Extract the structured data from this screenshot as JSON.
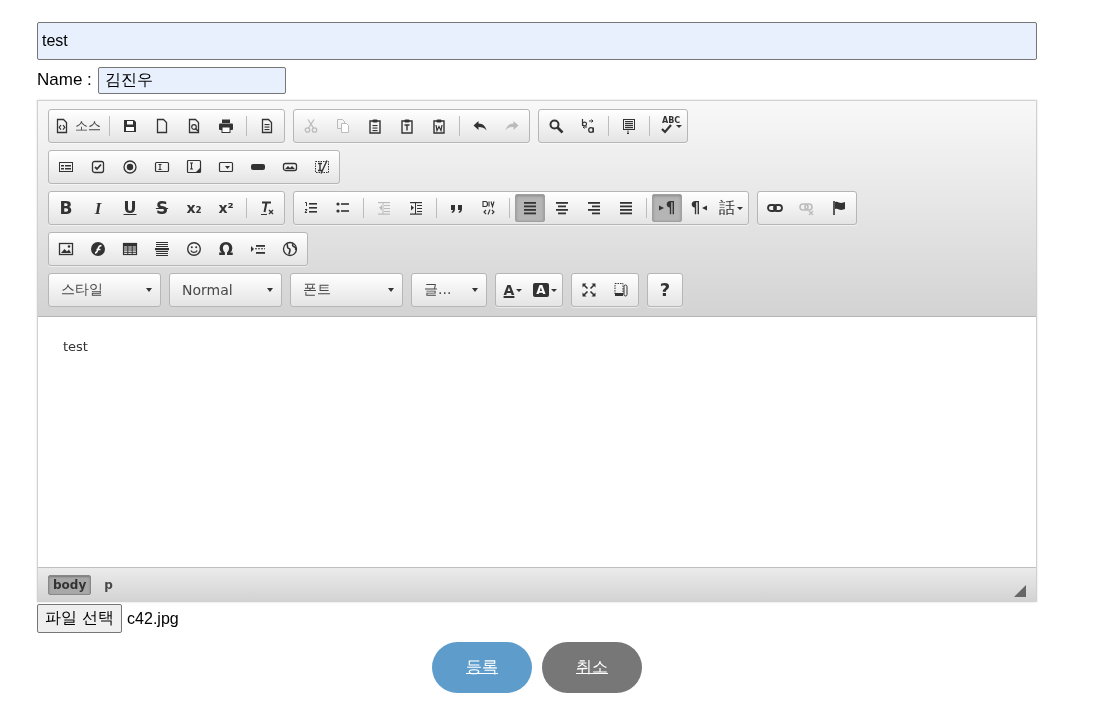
{
  "title_field": {
    "value": "test"
  },
  "name_field": {
    "label": "Name :",
    "value": "김진우"
  },
  "editor": {
    "toolbar": [
      {
        "items": [
          {
            "kind": "group",
            "items": [
              {
                "kind": "button",
                "label": "소스",
                "disabled": false
              },
              {
                "kind": "separator"
              },
              {
                "kind": "button",
                "disabled": false
              },
              {
                "kind": "button",
                "disabled": false
              },
              {
                "kind": "button",
                "disabled": false
              },
              {
                "kind": "button",
                "disabled": false
              },
              {
                "kind": "separator"
              },
              {
                "kind": "button",
                "disabled": false
              }
            ]
          },
          {
            "kind": "group",
            "items": [
              {
                "kind": "button",
                "disabled": true
              },
              {
                "kind": "button",
                "disabled": true
              },
              {
                "kind": "button",
                "disabled": false
              },
              {
                "kind": "button",
                "disabled": false
              },
              {
                "kind": "button",
                "disabled": false
              },
              {
                "kind": "separator"
              },
              {
                "kind": "button",
                "disabled": false
              },
              {
                "kind": "button",
                "disabled": true
              }
            ]
          },
          {
            "kind": "group",
            "items": [
              {
                "kind": "button",
                "disabled": false
              },
              {
                "kind": "button",
                "disabled": false
              },
              {
                "kind": "separator"
              },
              {
                "kind": "button",
                "disabled": false
              },
              {
                "kind": "separator"
              },
              {
                "kind": "menubutton",
                "glyph": "ABC",
                "disabled": false
              }
            ]
          }
        ]
      },
      {
        "items": [
          {
            "kind": "group",
            "items": [
              {
                "kind": "button",
                "disabled": false
              },
              {
                "kind": "button",
                "disabled": false
              },
              {
                "kind": "button",
                "disabled": false
              },
              {
                "kind": "button",
                "disabled": false
              },
              {
                "kind": "button",
                "disabled": false
              },
              {
                "kind": "button",
                "disabled": false
              },
              {
                "kind": "button",
                "disabled": false
              },
              {
                "kind": "button",
                "disabled": false
              },
              {
                "kind": "button",
                "disabled": false
              }
            ]
          }
        ]
      },
      {
        "items": [
          {
            "kind": "group",
            "items": [
              {
                "kind": "button",
                "glyph": "B",
                "disabled": false
              },
              {
                "kind": "button",
                "glyph": "I",
                "disabled": false
              },
              {
                "kind": "button",
                "glyph": "U",
                "disabled": false
              },
              {
                "kind": "button",
                "glyph": "S",
                "disabled": false
              },
              {
                "kind": "button",
                "glyph": "x₂",
                "disabled": false
              },
              {
                "kind": "button",
                "glyph": "x²",
                "disabled": false
              },
              {
                "kind": "separator"
              },
              {
                "kind": "button",
                "disabled": false
              }
            ]
          },
          {
            "kind": "group",
            "items": [
              {
                "kind": "button",
                "disabled": false,
                "on": false
              },
              {
                "kind": "button",
                "disabled": false,
                "on": false
              },
              {
                "kind": "separator"
              },
              {
                "kind": "button",
                "disabled": true,
                "on": false
              },
              {
                "kind": "button",
                "disabled": false,
                "on": false
              },
              {
                "kind": "separator"
              },
              {
                "kind": "button",
                "disabled": false,
                "on": false
              },
              {
                "kind": "button",
                "disabled": false,
                "on": false
              },
              {
                "kind": "separator"
              },
              {
                "kind": "button",
                "disabled": false,
                "on": true
              },
              {
                "kind": "button",
                "disabled": false,
                "on": false
              },
              {
                "kind": "button",
                "disabled": false,
                "on": false
              },
              {
                "kind": "button",
                "disabled": false,
                "on": false
              },
              {
                "kind": "separator"
              },
              {
                "kind": "button",
                "glyph": "¶",
                "disabled": false,
                "on": true
              },
              {
                "kind": "button",
                "glyph": "¶",
                "disabled": false,
                "on": false
              },
              {
                "kind": "menubutton",
                "glyph": "話",
                "disabled": false,
                "on": false
              }
            ]
          },
          {
            "kind": "group",
            "items": [
              {
                "kind": "button",
                "disabled": false
              },
              {
                "kind": "button",
                "disabled": true
              },
              {
                "kind": "button",
                "disabled": false
              }
            ]
          }
        ]
      },
      {
        "items": [
          {
            "kind": "group",
            "items": [
              {
                "kind": "button",
                "disabled": false
              },
              {
                "kind": "button",
                "disabled": false
              },
              {
                "kind": "button",
                "disabled": false
              },
              {
                "kind": "button",
                "disabled": false
              },
              {
                "kind": "button",
                "disabled": false
              },
              {
                "kind": "button",
                "glyph": "Ω",
                "disabled": false
              },
              {
                "kind": "button",
                "disabled": false
              },
              {
                "kind": "button",
                "disabled": false
              }
            ]
          }
        ]
      },
      {
        "items": [
          {
            "kind": "combo",
            "label": "스타일"
          },
          {
            "kind": "combo",
            "label": "Normal"
          },
          {
            "kind": "combo",
            "label": "폰트"
          },
          {
            "kind": "combo",
            "label": "글..."
          },
          {
            "kind": "group",
            "items": [
              {
                "kind": "menubutton",
                "glyph": "A",
                "disabled": false
              },
              {
                "kind": "menubutton",
                "glyph": "A",
                "disabled": false
              }
            ]
          },
          {
            "kind": "group",
            "items": [
              {
                "kind": "button",
                "disabled": false
              },
              {
                "kind": "button",
                "disabled": false
              }
            ]
          },
          {
            "kind": "group",
            "items": [
              {
                "kind": "button",
                "glyph": "?",
                "disabled": false
              }
            ]
          }
        ]
      }
    ],
    "content": "test",
    "path": [
      {
        "label": "body",
        "selected": true
      },
      {
        "label": "p",
        "selected": false
      }
    ]
  },
  "file": {
    "button": "파일 선택",
    "filename": "c42.jpg"
  },
  "actions": [
    {
      "label": "등록",
      "kind": "primary"
    },
    {
      "label": "취소",
      "kind": "secondary"
    }
  ]
}
